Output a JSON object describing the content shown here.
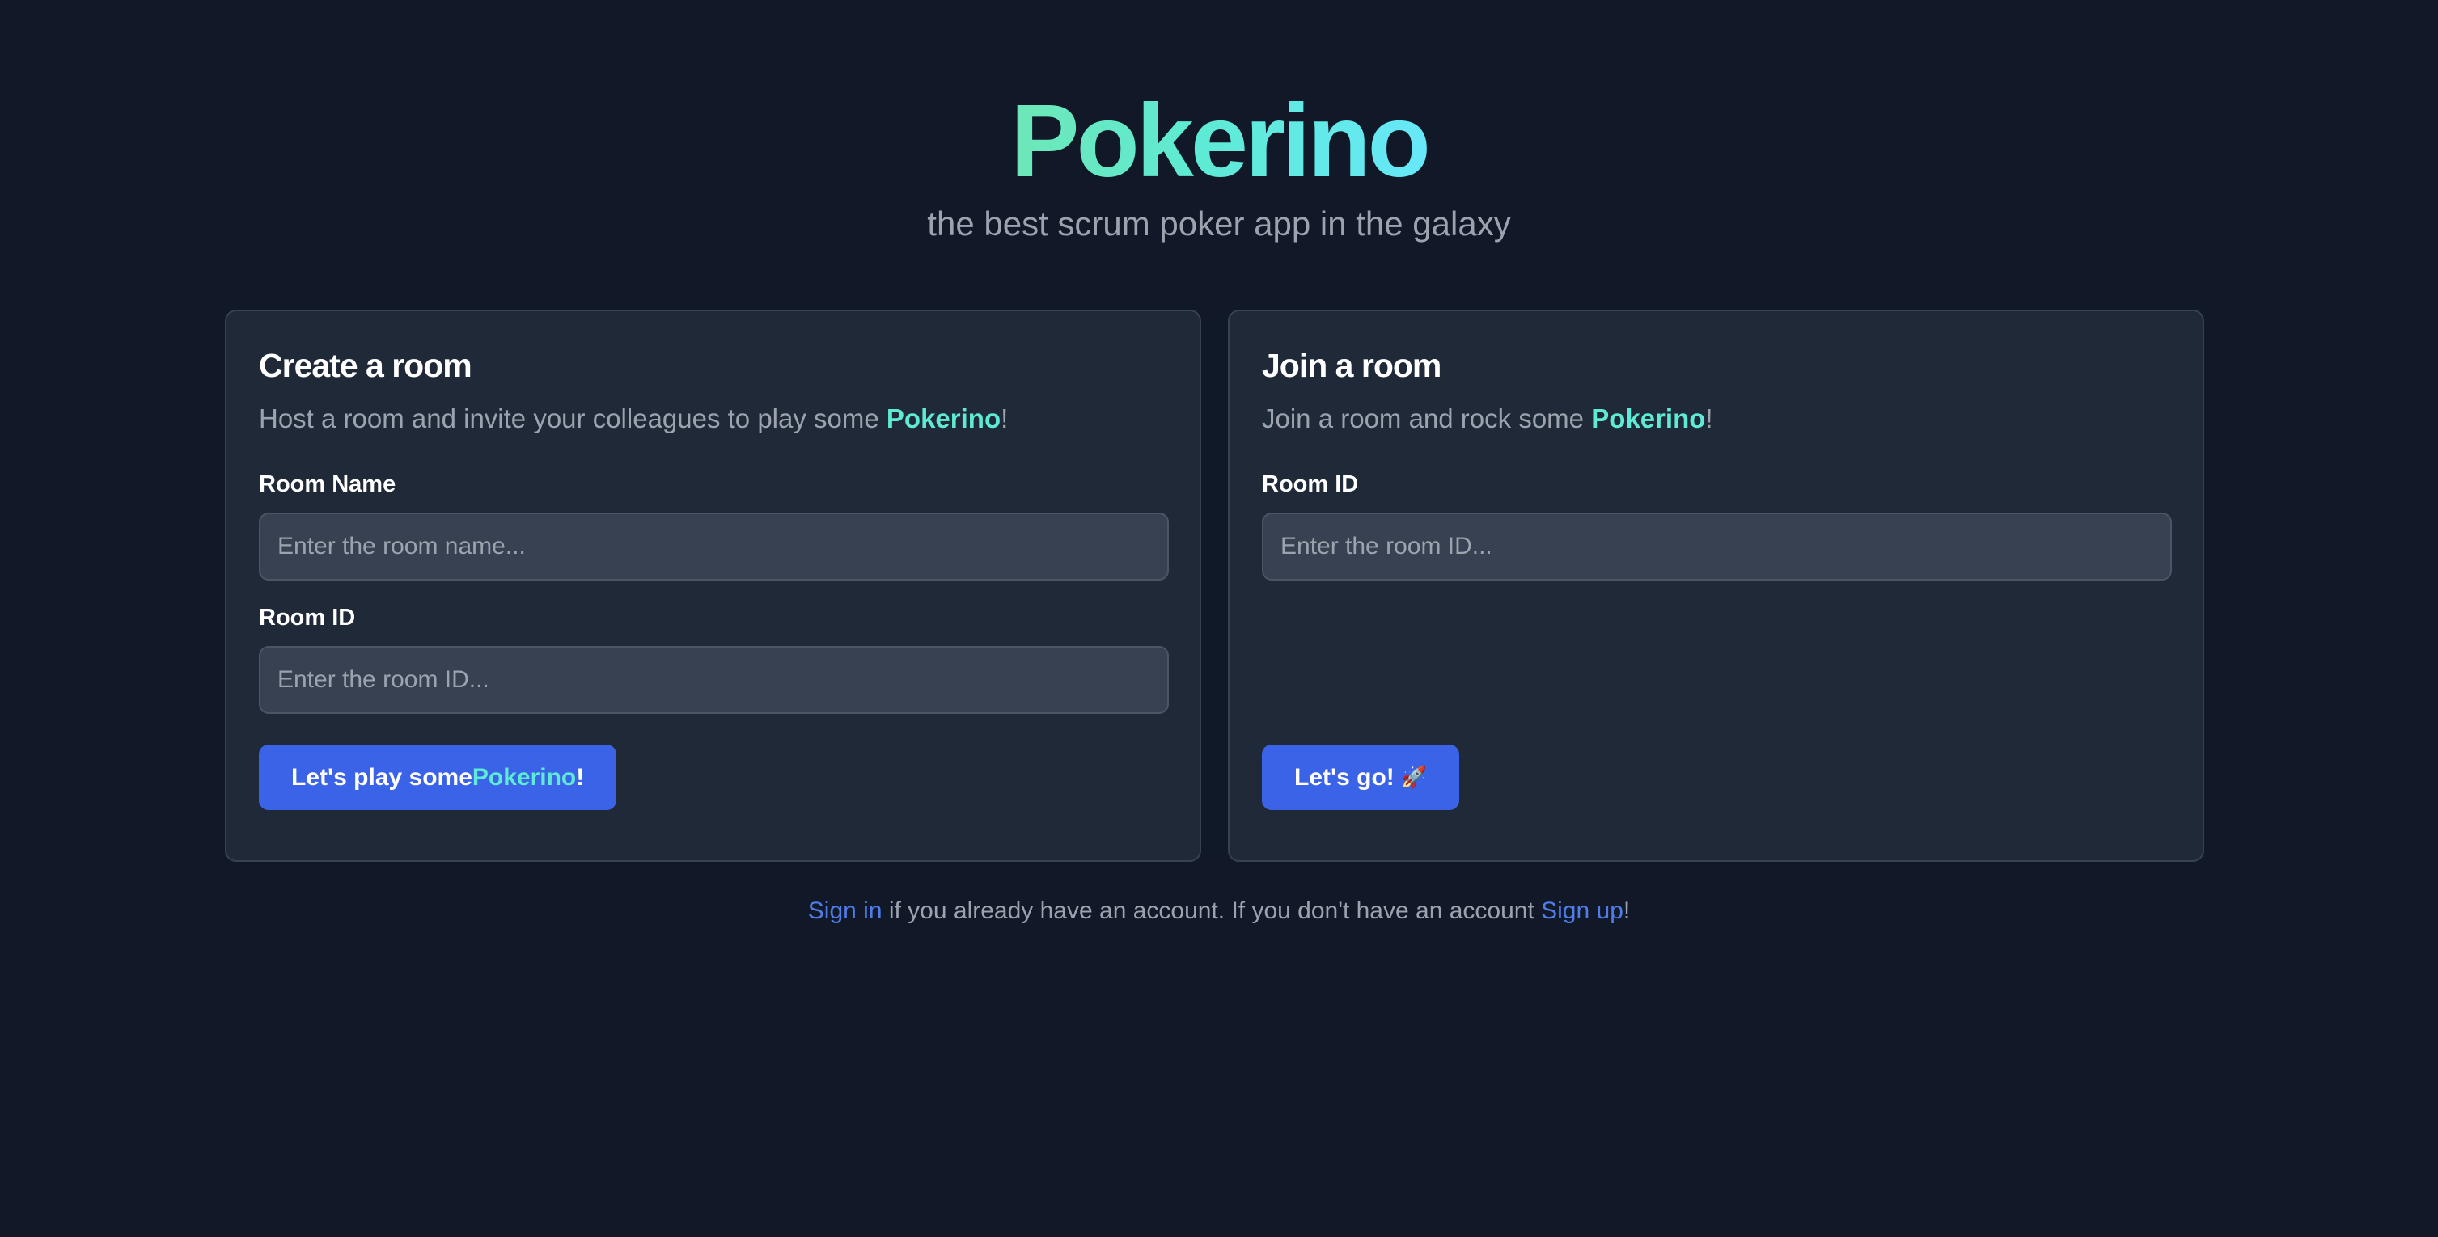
{
  "app": {
    "title": "Pokerino",
    "tagline": "the best scrum poker app in the galaxy"
  },
  "create_room": {
    "title": "Create a room",
    "desc_prefix": "Host a room and invite your colleagues to play some",
    "desc_brand": "Pokerino",
    "desc_suffix": "!",
    "room_name_label": "Room Name",
    "room_name_placeholder": "Enter the room name...",
    "room_name_value": "",
    "room_id_label": "Room ID",
    "room_id_placeholder": "Enter the room ID...",
    "room_id_value": "",
    "button_prefix": "Let's play some ",
    "button_brand": "Pokerino",
    "button_suffix": "!"
  },
  "join_room": {
    "title": "Join a room",
    "desc_prefix": "Join a room and rock some",
    "desc_brand": "Pokerino",
    "desc_suffix": "!",
    "room_id_label": "Room ID",
    "room_id_placeholder": "Enter the room ID...",
    "room_id_value": "",
    "button_label": "Let's go!",
    "button_emoji": "🚀"
  },
  "footer": {
    "sign_in": "Sign in",
    "middle_text": " if you already have an account. If you don't have an account ",
    "sign_up": "Sign up",
    "end": "!"
  },
  "colors": {
    "background": "#111827",
    "card": "#1f2937",
    "brand_accent": "#5eead4",
    "primary_button": "#3b63e8",
    "link": "#4f7ce8"
  }
}
